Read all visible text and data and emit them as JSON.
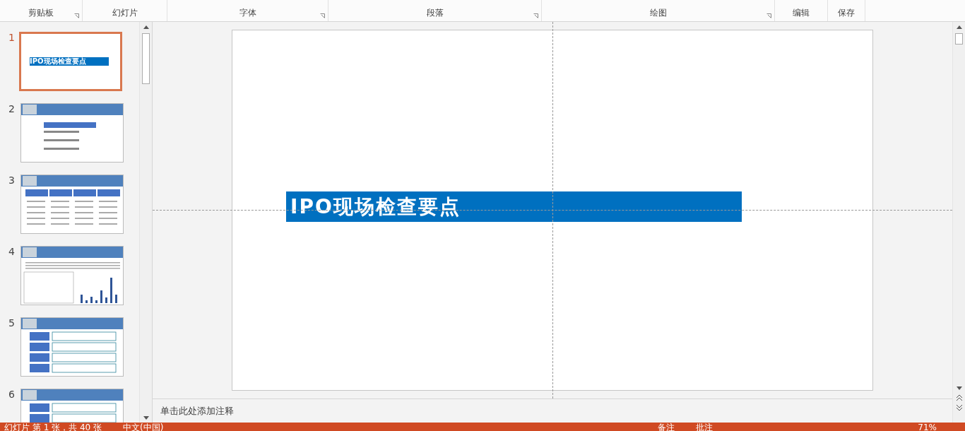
{
  "ribbon": {
    "groups": [
      {
        "label": "剪贴板",
        "launcher": true
      },
      {
        "label": "幻灯片",
        "launcher": false
      },
      {
        "label": "字体",
        "launcher": true
      },
      {
        "label": "段落",
        "launcher": true
      },
      {
        "label": "绘图",
        "launcher": true
      },
      {
        "label": "编辑",
        "launcher": false
      },
      {
        "label": "保存",
        "launcher": false
      }
    ]
  },
  "slides": [
    {
      "number": "1",
      "selected": true,
      "kind": "title",
      "title": "IPO现场检查要点"
    },
    {
      "number": "2",
      "selected": false,
      "kind": "agenda"
    },
    {
      "number": "3",
      "selected": false,
      "kind": "columns"
    },
    {
      "number": "4",
      "selected": false,
      "kind": "chart"
    },
    {
      "number": "5",
      "selected": false,
      "kind": "table"
    },
    {
      "number": "6",
      "selected": false,
      "kind": "table"
    }
  ],
  "editor": {
    "title": "IPO现场检查要点",
    "notes_placeholder": "单击此处添加注释"
  },
  "status_bar": {
    "slide_info": "幻灯片 第 1 张，共 40 张",
    "language": "中文(中国)",
    "notes": "备注",
    "comments": "批注",
    "zoom": "71%"
  }
}
